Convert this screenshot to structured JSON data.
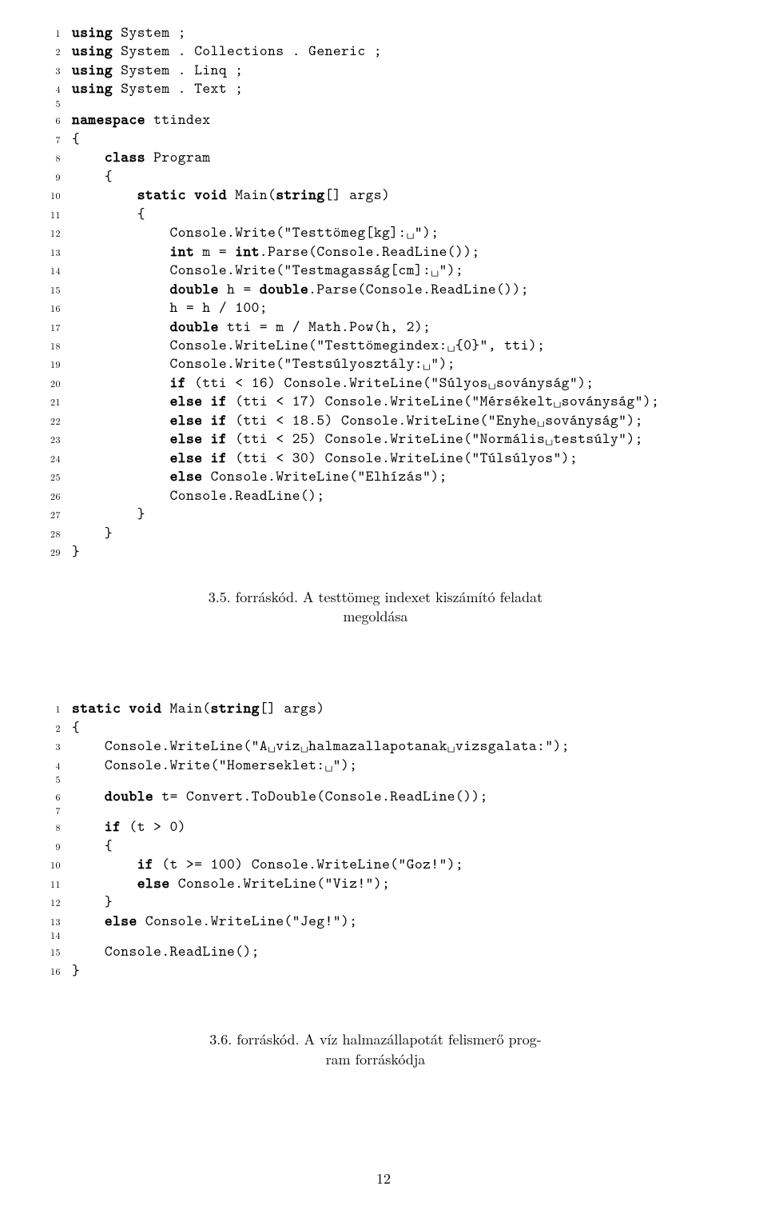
{
  "block1": {
    "lines": [
      {
        "n": "1",
        "segs": [
          {
            "t": "using",
            "b": true
          },
          {
            "t": " System ;"
          }
        ]
      },
      {
        "n": "2",
        "segs": [
          {
            "t": "using",
            "b": true
          },
          {
            "t": " System . Collections . Generic ;"
          }
        ]
      },
      {
        "n": "3",
        "segs": [
          {
            "t": "using",
            "b": true
          },
          {
            "t": " System . Linq ;"
          }
        ]
      },
      {
        "n": "4",
        "segs": [
          {
            "t": "using",
            "b": true
          },
          {
            "t": " System . Text ;"
          }
        ]
      },
      {
        "n": "5",
        "segs": [
          {
            "t": ""
          }
        ]
      },
      {
        "n": "6",
        "segs": [
          {
            "t": "namespace",
            "b": true
          },
          {
            "t": " ttindex"
          }
        ]
      },
      {
        "n": "7",
        "segs": [
          {
            "t": "{"
          }
        ]
      },
      {
        "n": "8",
        "segs": [
          {
            "t": "    "
          },
          {
            "t": "class",
            "b": true
          },
          {
            "t": " Program"
          }
        ]
      },
      {
        "n": "9",
        "segs": [
          {
            "t": "    {"
          }
        ]
      },
      {
        "n": "10",
        "segs": [
          {
            "t": "        "
          },
          {
            "t": "static void",
            "b": true
          },
          {
            "t": " Main("
          },
          {
            "t": "string",
            "b": true
          },
          {
            "t": "[] args)"
          }
        ]
      },
      {
        "n": "11",
        "segs": [
          {
            "t": "        {"
          }
        ]
      },
      {
        "n": "12",
        "segs": [
          {
            "t": "            Console.Write(\"Testtömeg[kg]:␣\");"
          }
        ]
      },
      {
        "n": "13",
        "segs": [
          {
            "t": "            "
          },
          {
            "t": "int",
            "b": true
          },
          {
            "t": " m = "
          },
          {
            "t": "int",
            "b": true
          },
          {
            "t": ".Parse(Console.ReadLine());"
          }
        ]
      },
      {
        "n": "14",
        "segs": [
          {
            "t": "            Console.Write(\"Testmagasság[cm]:␣\");"
          }
        ]
      },
      {
        "n": "15",
        "segs": [
          {
            "t": "            "
          },
          {
            "t": "double",
            "b": true
          },
          {
            "t": " h = "
          },
          {
            "t": "double",
            "b": true
          },
          {
            "t": ".Parse(Console.ReadLine());"
          }
        ]
      },
      {
        "n": "16",
        "segs": [
          {
            "t": "            h = h / 100;"
          }
        ]
      },
      {
        "n": "17",
        "segs": [
          {
            "t": "            "
          },
          {
            "t": "double",
            "b": true
          },
          {
            "t": " tti = m / Math.Pow(h, 2);"
          }
        ]
      },
      {
        "n": "18",
        "segs": [
          {
            "t": "            Console.WriteLine(\"Testtömegindex:␣{0}\", tti);"
          }
        ]
      },
      {
        "n": "19",
        "segs": [
          {
            "t": "            Console.Write(\"Testsúlyosztály:␣\");"
          }
        ]
      },
      {
        "n": "20",
        "segs": [
          {
            "t": "            "
          },
          {
            "t": "if",
            "b": true
          },
          {
            "t": " (tti < 16) Console.WriteLine(\"Súlyos␣soványság\");"
          }
        ]
      },
      {
        "n": "21",
        "segs": [
          {
            "t": "            "
          },
          {
            "t": "else if",
            "b": true
          },
          {
            "t": " (tti < 17) Console.WriteLine(\"Mérsékelt␣soványság\");"
          }
        ]
      },
      {
        "n": "22",
        "segs": [
          {
            "t": "            "
          },
          {
            "t": "else if",
            "b": true
          },
          {
            "t": " (tti < 18.5) Console.WriteLine(\"Enyhe␣soványság\");"
          }
        ]
      },
      {
        "n": "23",
        "segs": [
          {
            "t": "            "
          },
          {
            "t": "else if",
            "b": true
          },
          {
            "t": " (tti < 25) Console.WriteLine(\"Normális␣testsúly\");"
          }
        ]
      },
      {
        "n": "24",
        "segs": [
          {
            "t": "            "
          },
          {
            "t": "else if",
            "b": true
          },
          {
            "t": " (tti < 30) Console.WriteLine(\"Túlsúlyos\");"
          }
        ]
      },
      {
        "n": "25",
        "segs": [
          {
            "t": "            "
          },
          {
            "t": "else",
            "b": true
          },
          {
            "t": " Console.WriteLine(\"Elhízás\");"
          }
        ]
      },
      {
        "n": "26",
        "segs": [
          {
            "t": "            Console.ReadLine();"
          }
        ]
      },
      {
        "n": "27",
        "segs": [
          {
            "t": "        }"
          }
        ]
      },
      {
        "n": "28",
        "segs": [
          {
            "t": "    }"
          }
        ]
      },
      {
        "n": "29",
        "segs": [
          {
            "t": "}"
          }
        ]
      }
    ]
  },
  "caption1": {
    "line1": "3.5. forráskód. A testtömeg indexet kiszámító feladat",
    "line2": "megoldása"
  },
  "block2": {
    "lines": [
      {
        "n": "1",
        "segs": [
          {
            "t": "static void",
            "b": true
          },
          {
            "t": " Main("
          },
          {
            "t": "string",
            "b": true
          },
          {
            "t": "[] args)"
          }
        ]
      },
      {
        "n": "2",
        "segs": [
          {
            "t": "{"
          }
        ]
      },
      {
        "n": "3",
        "segs": [
          {
            "t": "    Console.WriteLine(\"A␣viz␣halmazallapotanak␣vizsgalata:\");"
          }
        ]
      },
      {
        "n": "4",
        "segs": [
          {
            "t": "    Console.Write(\"Homerseklet:␣\");"
          }
        ]
      },
      {
        "n": "5",
        "segs": [
          {
            "t": ""
          }
        ]
      },
      {
        "n": "6",
        "segs": [
          {
            "t": "    "
          },
          {
            "t": "double",
            "b": true
          },
          {
            "t": " t= Convert.ToDouble(Console.ReadLine());"
          }
        ]
      },
      {
        "n": "7",
        "segs": [
          {
            "t": ""
          }
        ]
      },
      {
        "n": "8",
        "segs": [
          {
            "t": "    "
          },
          {
            "t": "if",
            "b": true
          },
          {
            "t": " (t > 0)"
          }
        ]
      },
      {
        "n": "9",
        "segs": [
          {
            "t": "    {"
          }
        ]
      },
      {
        "n": "10",
        "segs": [
          {
            "t": "        "
          },
          {
            "t": "if",
            "b": true
          },
          {
            "t": " (t >= 100) Console.WriteLine(\"Goz!\");"
          }
        ]
      },
      {
        "n": "11",
        "segs": [
          {
            "t": "        "
          },
          {
            "t": "else",
            "b": true
          },
          {
            "t": " Console.WriteLine(\"Viz!\");"
          }
        ]
      },
      {
        "n": "12",
        "segs": [
          {
            "t": "    }"
          }
        ]
      },
      {
        "n": "13",
        "segs": [
          {
            "t": "    "
          },
          {
            "t": "else",
            "b": true
          },
          {
            "t": " Console.WriteLine(\"Jeg!\");"
          }
        ]
      },
      {
        "n": "14",
        "segs": [
          {
            "t": ""
          }
        ]
      },
      {
        "n": "15",
        "segs": [
          {
            "t": "    Console.ReadLine();"
          }
        ]
      },
      {
        "n": "16",
        "segs": [
          {
            "t": "}"
          }
        ]
      }
    ]
  },
  "caption2": {
    "line1": "3.6. forráskód. A víz halmazállapotát felismerő prog-",
    "line2": "ram forráskódja"
  },
  "pagenum": "12"
}
